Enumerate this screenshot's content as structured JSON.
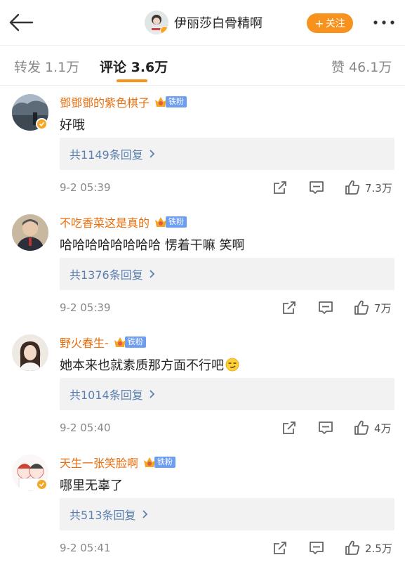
{
  "header": {
    "title": "伊丽莎白骨精啊",
    "follow_label": "关注",
    "follow_plus": "+"
  },
  "tabs": [
    {
      "label": "转发 1.1万"
    },
    {
      "label": "评论 3.6万"
    },
    {
      "label": "赞 46.1万"
    }
  ],
  "comments": [
    {
      "username": "鄧鄧鄧的紫色棋子",
      "fan_badge": "铁粉",
      "text": "好哦",
      "replies": "共1149条回复",
      "time": "9-2 05:39",
      "likes": "7.3万",
      "verified": true
    },
    {
      "username": "不吃香菜这是真的",
      "fan_badge": "铁粉",
      "text": "哈哈哈哈哈哈哈哈 愣着干嘛 笑啊",
      "replies": "共1376条回复",
      "time": "9-2 05:39",
      "likes": "7万",
      "verified": false
    },
    {
      "username": "野火春生-",
      "fan_badge": "铁粉",
      "text": "她本来也就素质那方面不行吧",
      "replies": "共1014条回复",
      "time": "9-2 05:40",
      "likes": "4万",
      "verified": false
    },
    {
      "username": "天生一张笑脸啊",
      "fan_badge": "铁粉",
      "text": "哪里无辜了",
      "replies": "共513条回复",
      "time": "9-2 05:41",
      "likes": "2.5万",
      "verified": true
    }
  ],
  "colors": {
    "accent": "#f7921e",
    "username": "#e86e0e",
    "reply_link": "#5a7fb0",
    "fan_badge": "#6e9ef0"
  },
  "icons": [
    "back-arrow-icon",
    "more-icon",
    "share-icon",
    "comment-icon",
    "like-icon",
    "chevron-right-icon",
    "crown-icon",
    "verified-icon",
    "smirk-emoji-icon"
  ]
}
